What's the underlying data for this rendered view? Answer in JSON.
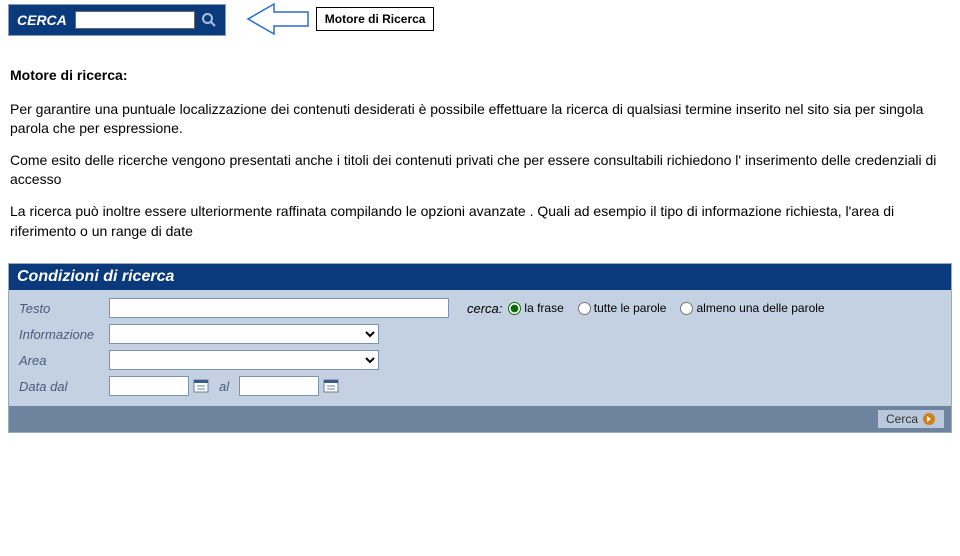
{
  "searchBar": {
    "label": "CERCA",
    "value": ""
  },
  "callout": {
    "text": "Motore di Ricerca"
  },
  "bodyText": {
    "heading": "Motore di ricerca:",
    "p1": "Per garantire una puntuale localizzazione dei contenuti desiderati è possibile effettuare la ricerca di qualsiasi termine inserito nel sito sia per singola parola che per espressione.",
    "p2": "Come esito delle ricerche vengono presentati anche i titoli dei contenuti privati che per essere consultabili richiedono l' inserimento delle credenziali di accesso",
    "p3": "La ricerca può inoltre essere ulteriormente raffinata compilando le opzioni avanzate . Quali ad esempio il tipo di informazione richiesta, l'area di riferimento  o un range di date"
  },
  "form": {
    "panelTitle": "Condizioni di ricerca",
    "labels": {
      "testo": "Testo",
      "informazione": "Informazione",
      "area": "Area",
      "dataDal": "Data dal",
      "al": "al",
      "cerca": "cerca:"
    },
    "radios": {
      "opt1": "la frase",
      "opt2": "tutte le parole",
      "opt3": "almeno una delle parole"
    },
    "values": {
      "testo": "",
      "informazione": "",
      "area": "",
      "dataDal": "",
      "dataAl": ""
    },
    "submit": "Cerca"
  }
}
